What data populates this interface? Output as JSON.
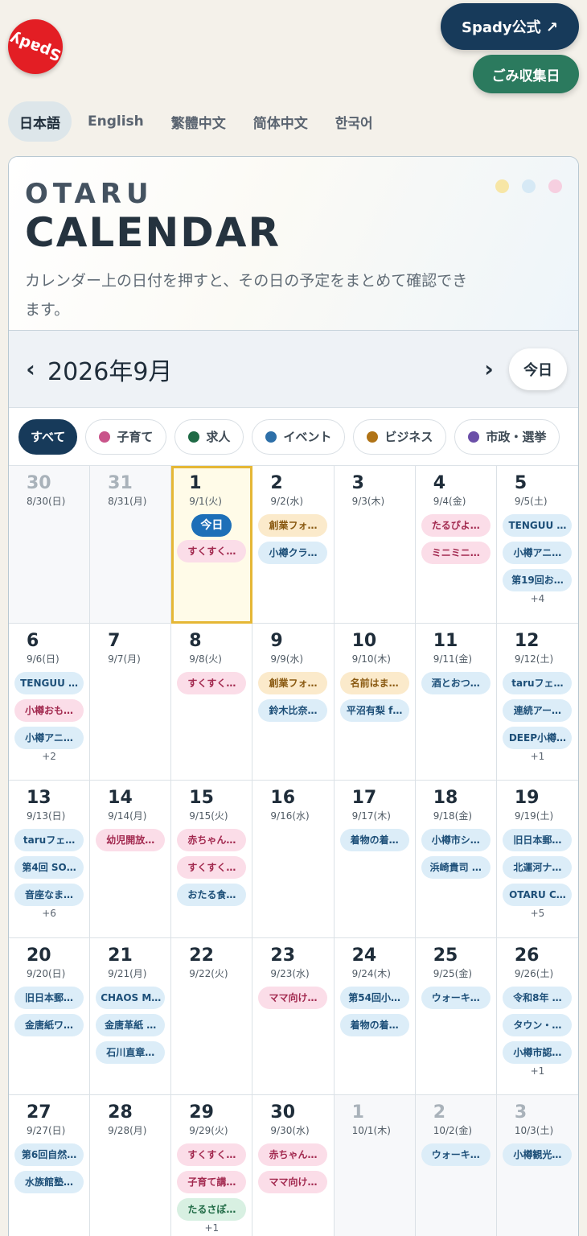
{
  "logo": {
    "text": "Spady"
  },
  "header_buttons": {
    "spady": "Spady公式 ↗",
    "gomi": "ごみ収集日"
  },
  "languages": [
    "日本語",
    "English",
    "繁體中文",
    "简体中文",
    "한국어"
  ],
  "active_language": "日本語",
  "hero": {
    "small": "OTARU",
    "big": "CALENDAR",
    "description": "カレンダー上の日付を押すと、その日の予定をまとめて確認できます。",
    "dot_colors": [
      "#f7e6a6",
      "#d6e9f5",
      "#f6cfe0"
    ]
  },
  "nav": {
    "prev": "‹",
    "month": "2026年9月",
    "next": "›",
    "today": "今日"
  },
  "filters": [
    {
      "label": "すべて",
      "active": true,
      "color": ""
    },
    {
      "label": "子育て",
      "active": false,
      "color": "#c9548a"
    },
    {
      "label": "求人",
      "active": false,
      "color": "#1f6a45"
    },
    {
      "label": "イベント",
      "active": false,
      "color": "#2d6fa8"
    },
    {
      "label": "ビジネス",
      "active": false,
      "color": "#b07316"
    },
    {
      "label": "市政・選挙",
      "active": false,
      "color": "#6b4fa8"
    }
  ],
  "today_badge": "今日",
  "colors": {
    "navy": "#173a5a",
    "green": "#2b7a5e",
    "today_outline": "#e5b735"
  },
  "days": [
    {
      "num": "30",
      "sub": "8/30(日)",
      "out": true,
      "events": []
    },
    {
      "num": "31",
      "sub": "8/31(月)",
      "out": true,
      "events": []
    },
    {
      "num": "1",
      "sub": "9/1(火)",
      "today": true,
      "events": [
        {
          "t": "すくすく…",
          "c": "pink"
        }
      ]
    },
    {
      "num": "2",
      "sub": "9/2(水)",
      "events": [
        {
          "t": "創業フォ…",
          "c": "orange"
        },
        {
          "t": "小樽クラ…",
          "c": "blue"
        }
      ]
    },
    {
      "num": "3",
      "sub": "9/3(木)",
      "events": []
    },
    {
      "num": "4",
      "sub": "9/4(金)",
      "events": [
        {
          "t": "たるぴよ…",
          "c": "pink"
        },
        {
          "t": "ミニミニ…",
          "c": "pink"
        }
      ]
    },
    {
      "num": "5",
      "sub": "9/5(土)",
      "events": [
        {
          "t": "TENGUU …",
          "c": "blue"
        },
        {
          "t": "小樽アニ…",
          "c": "blue"
        },
        {
          "t": "第19回お…",
          "c": "blue"
        }
      ],
      "more": "+4"
    },
    {
      "num": "6",
      "sub": "9/6(日)",
      "events": [
        {
          "t": "TENGUU …",
          "c": "blue"
        },
        {
          "t": "小樽おも…",
          "c": "pink"
        },
        {
          "t": "小樽アニ…",
          "c": "blue"
        }
      ],
      "more": "+2"
    },
    {
      "num": "7",
      "sub": "9/7(月)",
      "events": []
    },
    {
      "num": "8",
      "sub": "9/8(火)",
      "events": [
        {
          "t": "すくすく…",
          "c": "pink"
        }
      ]
    },
    {
      "num": "9",
      "sub": "9/9(水)",
      "events": [
        {
          "t": "創業フォ…",
          "c": "orange"
        },
        {
          "t": "鈴木比奈…",
          "c": "blue"
        }
      ]
    },
    {
      "num": "10",
      "sub": "9/10(木)",
      "events": [
        {
          "t": "名前はま…",
          "c": "orange"
        },
        {
          "t": "平沼有梨 f…",
          "c": "blue"
        }
      ]
    },
    {
      "num": "11",
      "sub": "9/11(金)",
      "events": [
        {
          "t": "酒とおつ…",
          "c": "blue"
        }
      ]
    },
    {
      "num": "12",
      "sub": "9/12(土)",
      "events": [
        {
          "t": "taruフェ…",
          "c": "blue"
        },
        {
          "t": "連続アー…",
          "c": "blue"
        },
        {
          "t": "DEEP小樽…",
          "c": "blue"
        }
      ],
      "more": "+1"
    },
    {
      "num": "13",
      "sub": "9/13(日)",
      "events": [
        {
          "t": "taruフェ…",
          "c": "blue"
        },
        {
          "t": "第4回 SO…",
          "c": "blue"
        },
        {
          "t": "音座なま…",
          "c": "blue"
        }
      ],
      "more": "+6"
    },
    {
      "num": "14",
      "sub": "9/14(月)",
      "events": [
        {
          "t": "幼児開放…",
          "c": "pink"
        }
      ]
    },
    {
      "num": "15",
      "sub": "9/15(火)",
      "events": [
        {
          "t": "赤ちゃん…",
          "c": "pink"
        },
        {
          "t": "すくすく…",
          "c": "pink"
        },
        {
          "t": "おたる食…",
          "c": "blue"
        }
      ]
    },
    {
      "num": "16",
      "sub": "9/16(水)",
      "events": []
    },
    {
      "num": "17",
      "sub": "9/17(木)",
      "events": [
        {
          "t": "着物の着…",
          "c": "blue"
        }
      ]
    },
    {
      "num": "18",
      "sub": "9/18(金)",
      "events": [
        {
          "t": "小樽市シ…",
          "c": "blue"
        },
        {
          "t": "浜崎貴司 …",
          "c": "blue"
        }
      ]
    },
    {
      "num": "19",
      "sub": "9/19(土)",
      "events": [
        {
          "t": "旧日本郵…",
          "c": "blue"
        },
        {
          "t": "北運河ナ…",
          "c": "blue"
        },
        {
          "t": "OTARU C…",
          "c": "blue"
        }
      ],
      "more": "+5"
    },
    {
      "num": "20",
      "sub": "9/20(日)",
      "events": [
        {
          "t": "旧日本郵…",
          "c": "blue"
        },
        {
          "t": "金唐紙ワ…",
          "c": "blue"
        }
      ]
    },
    {
      "num": "21",
      "sub": "9/21(月)",
      "events": [
        {
          "t": "CHAOS M…",
          "c": "blue"
        },
        {
          "t": "金唐革紙 …",
          "c": "blue"
        },
        {
          "t": "石川直章…",
          "c": "blue"
        }
      ]
    },
    {
      "num": "22",
      "sub": "9/22(火)",
      "events": []
    },
    {
      "num": "23",
      "sub": "9/23(水)",
      "events": [
        {
          "t": "ママ向け…",
          "c": "pink"
        }
      ]
    },
    {
      "num": "24",
      "sub": "9/24(木)",
      "events": [
        {
          "t": "第54回小…",
          "c": "blue"
        },
        {
          "t": "着物の着…",
          "c": "blue"
        }
      ]
    },
    {
      "num": "25",
      "sub": "9/25(金)",
      "events": [
        {
          "t": "ウォーキ…",
          "c": "blue"
        }
      ]
    },
    {
      "num": "26",
      "sub": "9/26(土)",
      "events": [
        {
          "t": "令和8年 …",
          "c": "blue"
        },
        {
          "t": "タウン・…",
          "c": "blue"
        },
        {
          "t": "小樽市認…",
          "c": "blue"
        }
      ],
      "more": "+1"
    },
    {
      "num": "27",
      "sub": "9/27(日)",
      "events": [
        {
          "t": "第6回自然…",
          "c": "blue"
        },
        {
          "t": "水族館塾…",
          "c": "blue"
        }
      ]
    },
    {
      "num": "28",
      "sub": "9/28(月)",
      "events": []
    },
    {
      "num": "29",
      "sub": "9/29(火)",
      "events": [
        {
          "t": "すくすく…",
          "c": "pink"
        },
        {
          "t": "子育て講…",
          "c": "pink"
        },
        {
          "t": "たるさぽ…",
          "c": "green"
        }
      ],
      "more": "+1"
    },
    {
      "num": "30",
      "sub": "9/30(水)",
      "events": [
        {
          "t": "赤ちゃん…",
          "c": "pink"
        },
        {
          "t": "ママ向け…",
          "c": "pink"
        }
      ]
    },
    {
      "num": "1",
      "sub": "10/1(木)",
      "out": true,
      "events": []
    },
    {
      "num": "2",
      "sub": "10/2(金)",
      "out": true,
      "events": [
        {
          "t": "ウォーキ…",
          "c": "blue"
        }
      ]
    },
    {
      "num": "3",
      "sub": "10/3(土)",
      "out": true,
      "events": [
        {
          "t": "小樽観光…",
          "c": "blue"
        }
      ]
    }
  ]
}
